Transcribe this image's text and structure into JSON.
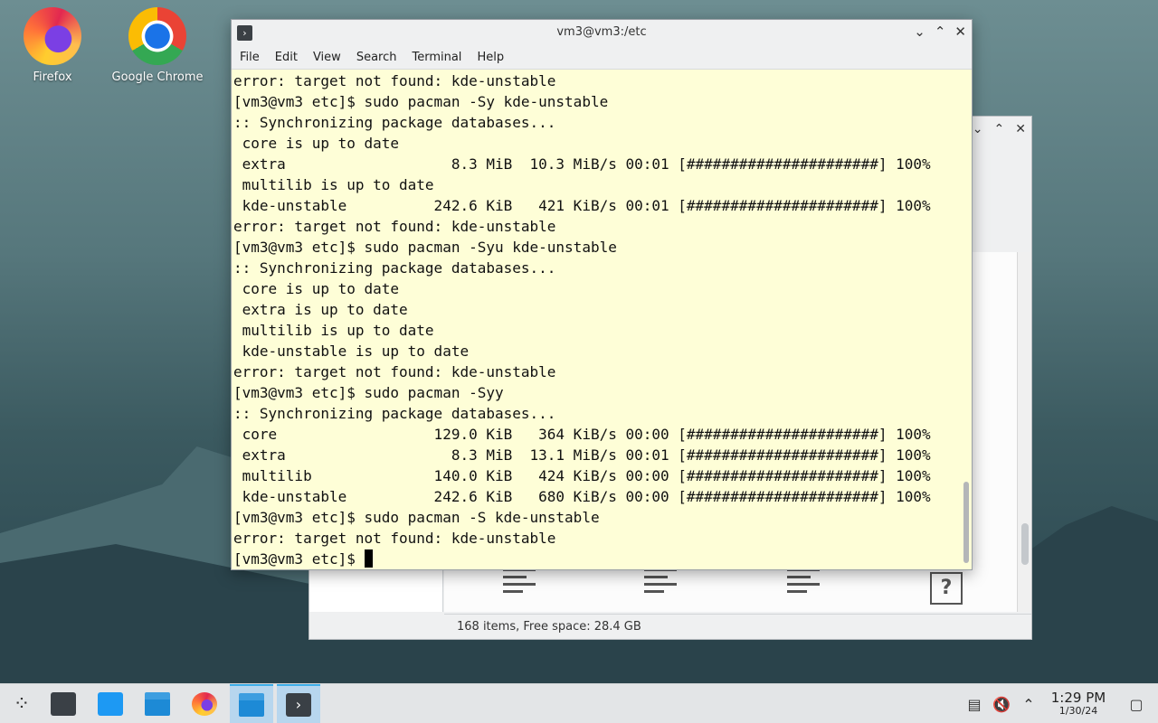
{
  "desktop": {
    "icons": [
      {
        "label": "Firefox"
      },
      {
        "label": "Google Chrome"
      }
    ]
  },
  "file_manager": {
    "status": "168 items, Free space: 28.4 GB"
  },
  "terminal": {
    "title": "vm3@vm3:/etc",
    "menu": [
      "File",
      "Edit",
      "View",
      "Search",
      "Terminal",
      "Help"
    ],
    "lines": [
      "error: target not found: kde-unstable",
      "[vm3@vm3 etc]$ sudo pacman -Sy kde-unstable",
      ":: Synchronizing package databases...",
      " core is up to date",
      " extra                   8.3 MiB  10.3 MiB/s 00:01 [######################] 100%",
      " multilib is up to date",
      " kde-unstable          242.6 KiB   421 KiB/s 00:01 [######################] 100%",
      "error: target not found: kde-unstable",
      "[vm3@vm3 etc]$ sudo pacman -Syu kde-unstable",
      ":: Synchronizing package databases...",
      " core is up to date",
      " extra is up to date",
      " multilib is up to date",
      " kde-unstable is up to date",
      "error: target not found: kde-unstable",
      "[vm3@vm3 etc]$ sudo pacman -Syy",
      ":: Synchronizing package databases...",
      " core                  129.0 KiB   364 KiB/s 00:00 [######################] 100%",
      " extra                   8.3 MiB  13.1 MiB/s 00:01 [######################] 100%",
      " multilib              140.0 KiB   424 KiB/s 00:00 [######################] 100%",
      " kde-unstable          242.6 KiB   680 KiB/s 00:00 [######################] 100%",
      "[vm3@vm3 etc]$ sudo pacman -S kde-unstable",
      "error: target not found: kde-unstable"
    ],
    "prompt": "[vm3@vm3 etc]$ "
  },
  "taskbar": {
    "clock_time": "1:29 PM",
    "clock_date": "1/30/24"
  }
}
